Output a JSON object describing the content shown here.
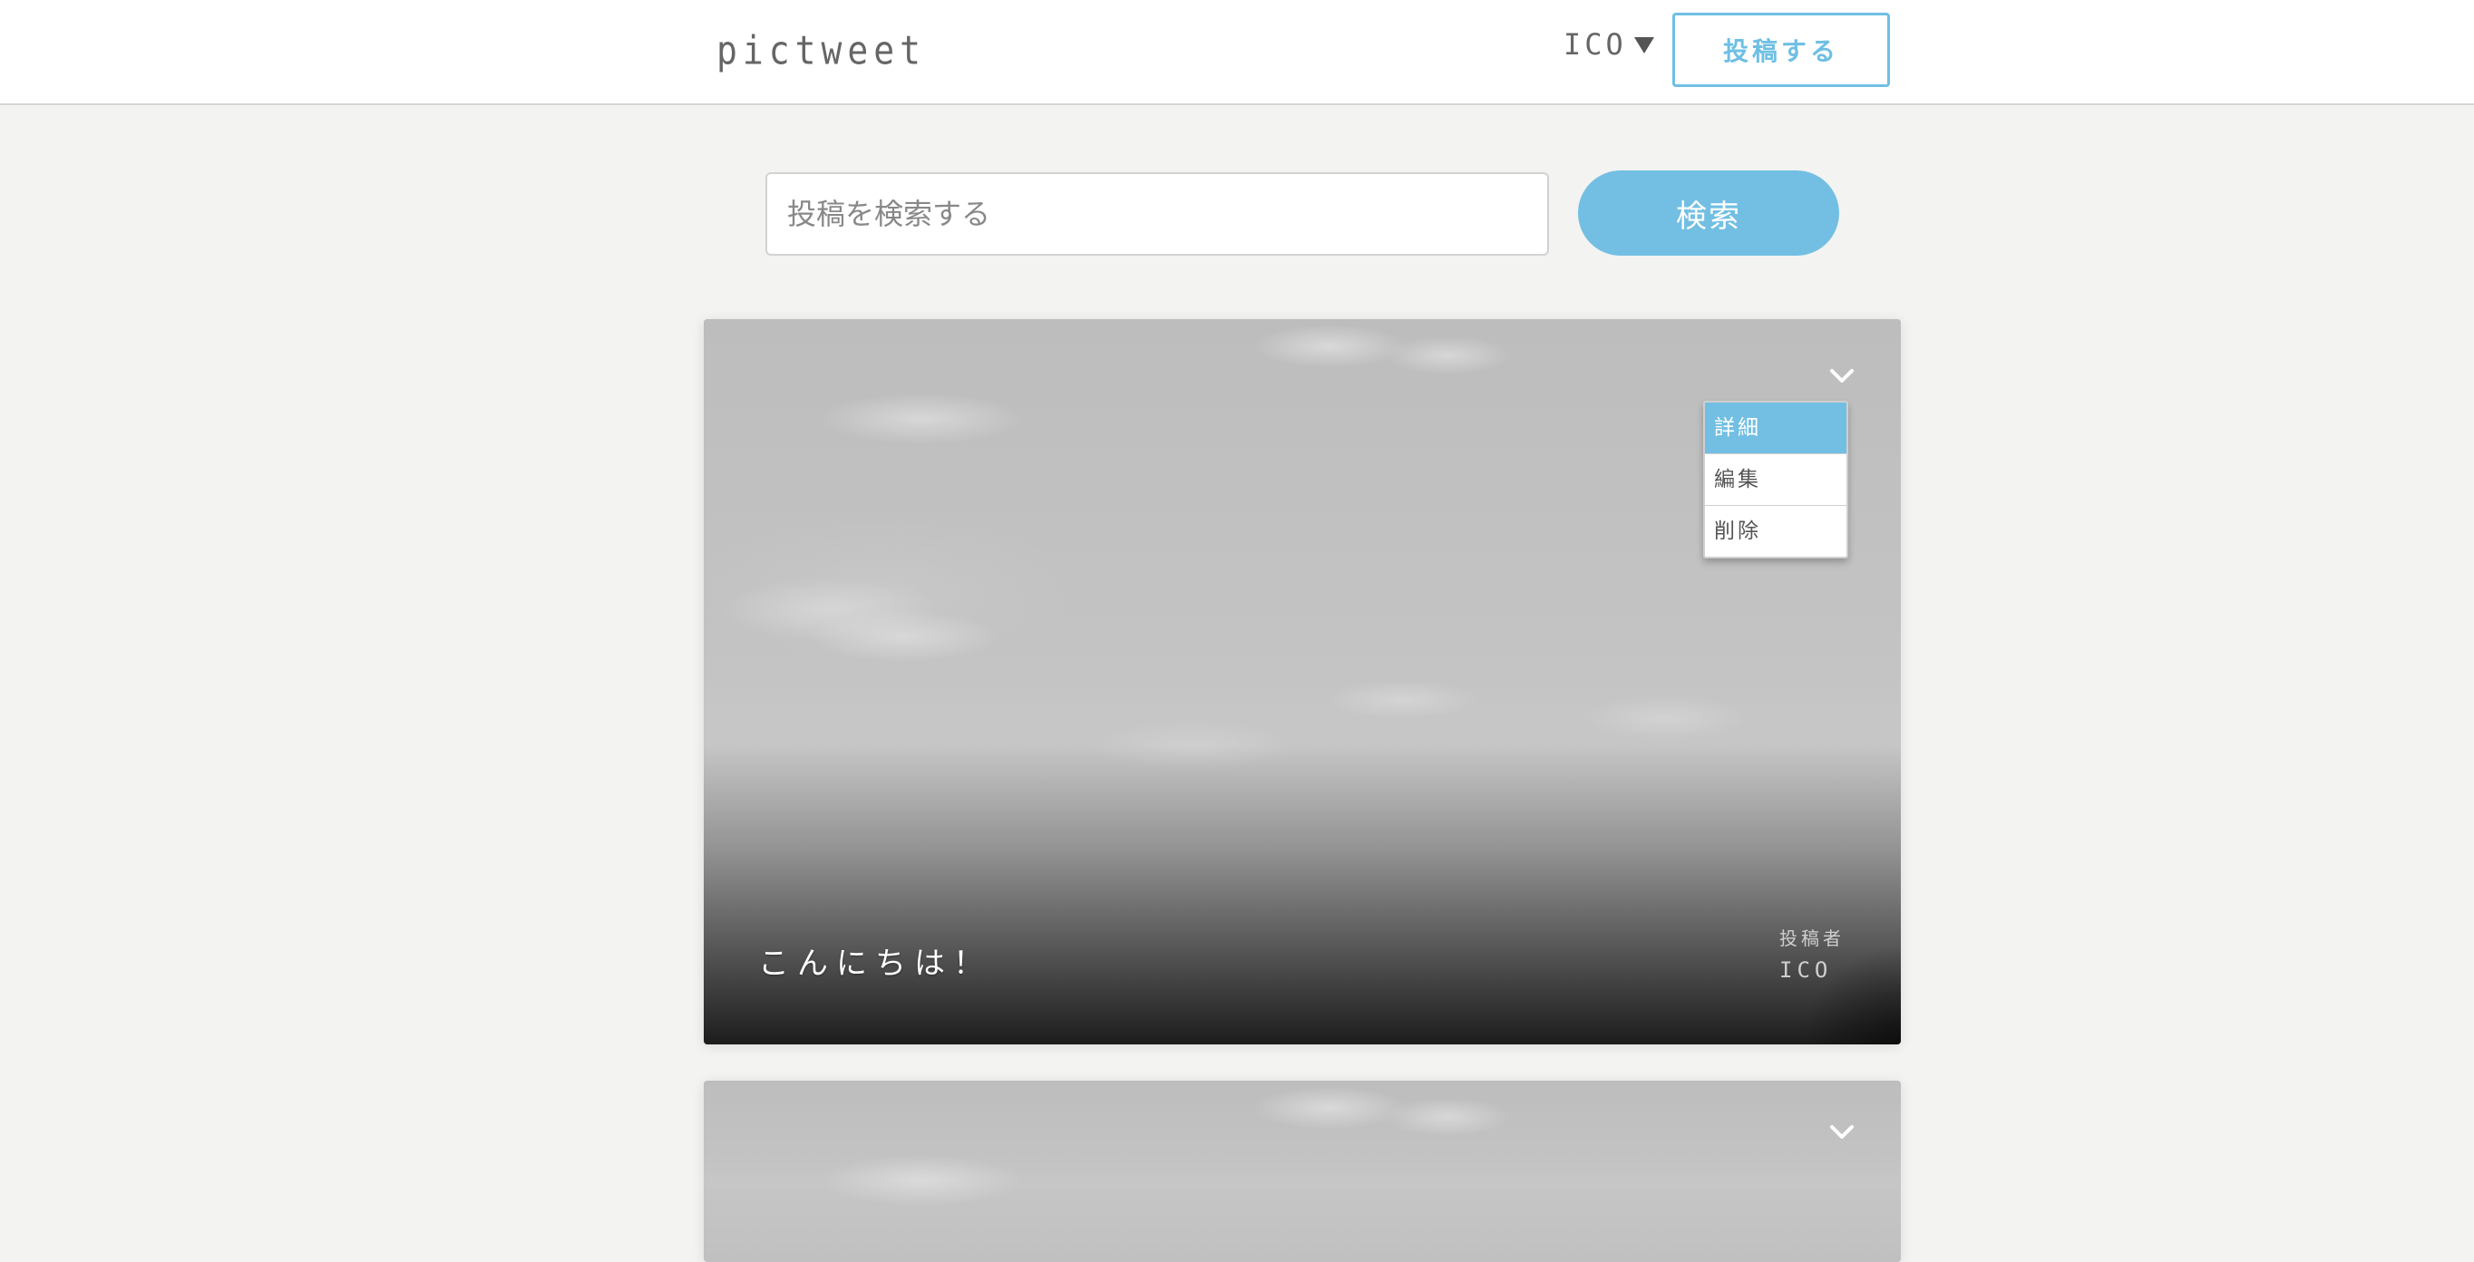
{
  "header": {
    "logo": "pictweet",
    "user_name": "ICO",
    "post_button_label": "投稿する"
  },
  "search": {
    "placeholder": "投稿を検索する",
    "value": "",
    "button_label": "検索"
  },
  "posts": [
    {
      "text": "こんにちは！",
      "author_label": "投稿者",
      "author_name": "ICO",
      "menu_open": true,
      "menu_items": [
        {
          "label": "詳細",
          "active": true
        },
        {
          "label": "編集",
          "active": false
        },
        {
          "label": "削除",
          "active": false
        }
      ]
    },
    {
      "text": "",
      "menu_open": false
    }
  ],
  "colors": {
    "accent": "#72bfe3",
    "background": "#f3f3f1"
  }
}
